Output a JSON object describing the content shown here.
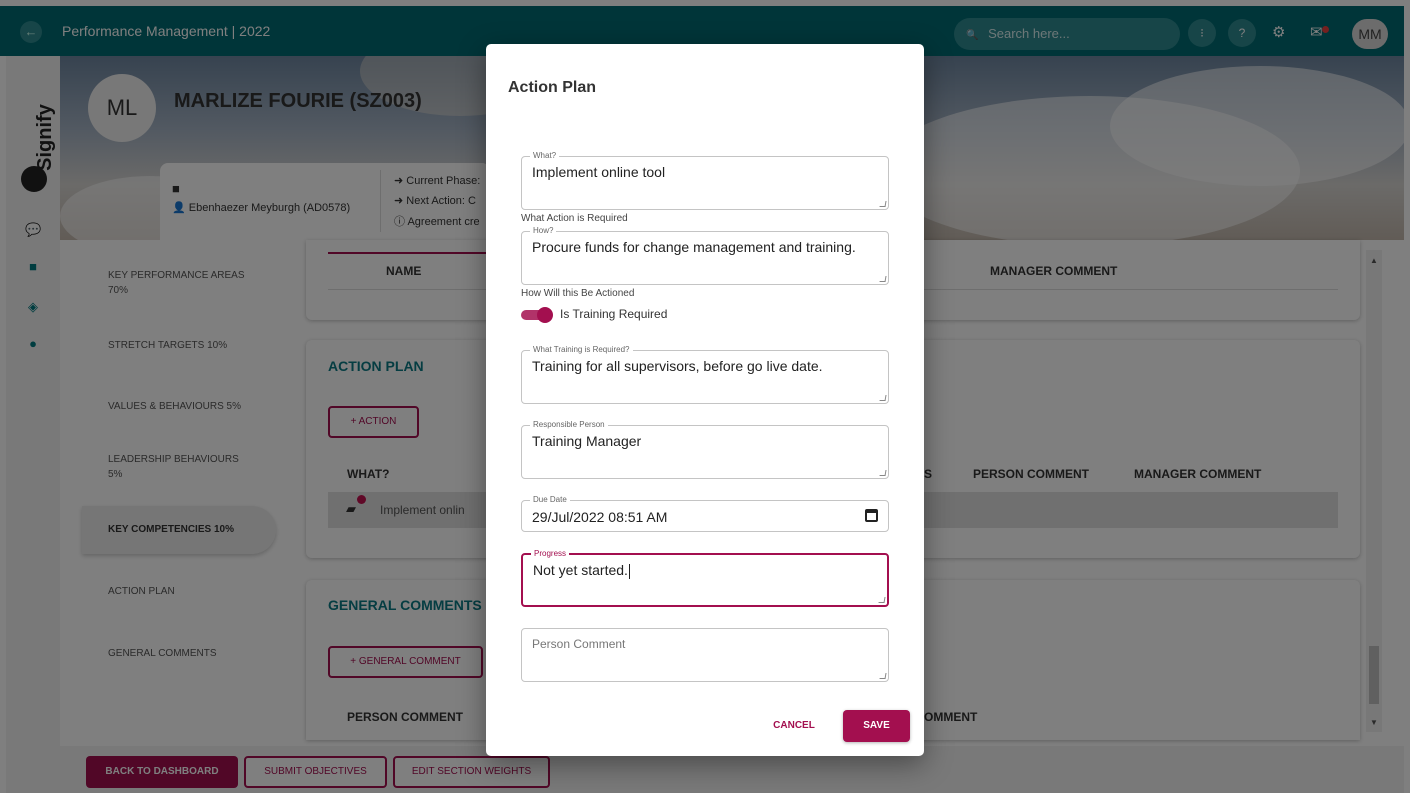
{
  "topbar": {
    "title": "Performance Management | 2022",
    "search_placeholder": "Search here...",
    "avatar_initials": "MM",
    "icon_more": "⁝",
    "icon_help": "?"
  },
  "profile": {
    "initials": "ML",
    "name": "MARLIZE FOURIE (SZ003)",
    "manager": "Ebenhaezer Meyburgh (AD0578)",
    "current_phase": "Current Phase:",
    "next_action": "Next Action: C",
    "agreement": "Agreement cre"
  },
  "logo": {
    "text": "Signify"
  },
  "menu": {
    "items": [
      {
        "label": "KEY PERFORMANCE AREAS",
        "sub": "70%"
      },
      {
        "label": "STRETCH TARGETS 10%"
      },
      {
        "label": "VALUES & BEHAVIOURS 5%"
      },
      {
        "label": "LEADERSHIP BEHAVIOURS",
        "sub": "5%"
      },
      {
        "label": "KEY COMPETENCIES 10%"
      },
      {
        "label": "ACTION PLAN"
      },
      {
        "label": "GENERAL COMMENTS"
      }
    ]
  },
  "kpa_card": {
    "col_name": "NAME",
    "col_manager_comment": "MANAGER COMMENT"
  },
  "action_plan_card": {
    "title": "ACTION PLAN",
    "add_button": "+ ACTION",
    "col_what": "WHAT?",
    "col_s": "S",
    "col_person_comment": "PERSON COMMENT",
    "col_manager_comment": "MANAGER COMMENT",
    "row_what": "Implement onlin"
  },
  "general_comments_card": {
    "title": "GENERAL COMMENTS",
    "add_button": "+ GENERAL COMMENT",
    "col_person_comment": "PERSON COMMENT",
    "col_manager_comment_partial": "OMMENT"
  },
  "bottombar": {
    "back": "BACK TO DASHBOARD",
    "submit": "SUBMIT OBJECTIVES",
    "edit": "EDIT SECTION WEIGHTS"
  },
  "dialog": {
    "title": "Action Plan",
    "what_legend": "What?",
    "what_value": "Implement online tool",
    "what_helper": "What Action is Required",
    "how_legend": "How?",
    "how_value": "Procure funds for change management and training.",
    "how_helper": "How Will this Be Actioned",
    "training_toggle_label": "Is Training Required",
    "training_toggle_on": true,
    "training_legend": "What Training is Required?",
    "training_value": "Training for all supervisors, before go live date.",
    "responsible_legend": "Responsible Person",
    "responsible_value": "Training Manager",
    "due_legend": "Due Date",
    "due_value": "29/Jul/2022 08:51  AM",
    "progress_legend": "Progress",
    "progress_value": "Not yet started.",
    "person_comment_placeholder": "Person Comment",
    "cancel": "CANCEL",
    "save": "SAVE"
  },
  "colors": {
    "teal": "#006b72",
    "accent": "#a30f4f",
    "title_teal": "#0b7a85"
  }
}
